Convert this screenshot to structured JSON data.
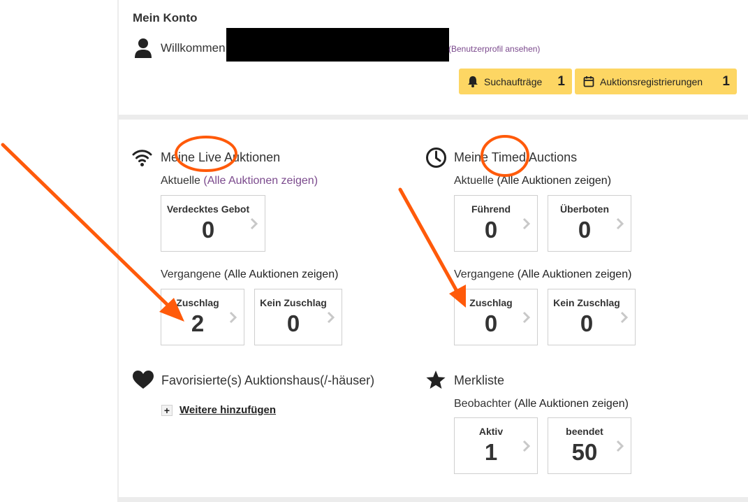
{
  "header": {
    "title": "Mein Konto",
    "welcome": "Willkommen",
    "profile_link": "(Benutzerprofil ansehen)"
  },
  "buttons": {
    "search_orders": {
      "label": "Suchaufträge",
      "count": "1"
    },
    "auction_reg": {
      "label": "Auktionsregistrierungen",
      "count": "1"
    }
  },
  "live": {
    "heading": "Meine Live Auktionen",
    "current_label": "Aktuelle",
    "current_link": "(Alle Auktionen zeigen)",
    "current_cards": [
      {
        "label": "Verdecktes Gebot",
        "value": "0"
      }
    ],
    "past_label": "Vergangene",
    "past_link": "(Alle Auktionen zeigen)",
    "past_cards": [
      {
        "label": "Zuschlag",
        "value": "2"
      },
      {
        "label": "Kein Zuschlag",
        "value": "0"
      }
    ]
  },
  "timed": {
    "heading": "Meine Timed Auctions",
    "current_label": "Aktuelle",
    "current_link": "(Alle Auktionen zeigen)",
    "current_cards": [
      {
        "label": "Führend",
        "value": "0"
      },
      {
        "label": "Überboten",
        "value": "0"
      }
    ],
    "past_label": "Vergangene",
    "past_link": "(Alle Auktionen zeigen)",
    "past_cards": [
      {
        "label": "Zuschlag",
        "value": "0"
      },
      {
        "label": "Kein Zuschlag",
        "value": "0"
      }
    ]
  },
  "favorites": {
    "heading": "Favorisierte(s) Auktionshaus(/-häuser)",
    "add_symbol": "+",
    "add_link": "Weitere hinzufügen"
  },
  "watchlist": {
    "heading": "Merkliste",
    "observer_label": "Beobachter",
    "observer_link": "(Alle Auktionen zeigen)",
    "cards": [
      {
        "label": "Aktiv",
        "value": "1"
      },
      {
        "label": "beendet",
        "value": "50"
      }
    ]
  },
  "colors": {
    "accent_yellow": "#fdd663",
    "link_purple": "#7b4a8d",
    "annotation_orange": "#ff5a0a"
  }
}
